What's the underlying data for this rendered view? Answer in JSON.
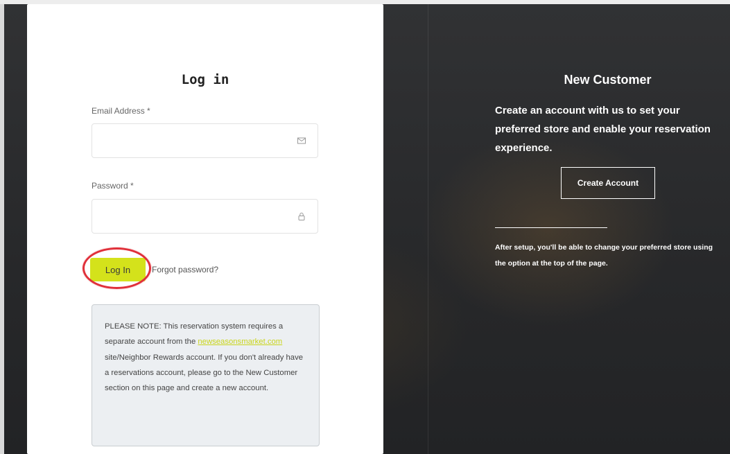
{
  "login": {
    "title": "Log in",
    "email_label": "Email Address *",
    "email_value": "",
    "password_label": "Password *",
    "password_value": "",
    "login_button": "Log In",
    "forgot_password": "Forgot password?",
    "note": {
      "text_before_link": "PLEASE NOTE: This reservation system requires a separate account from the ",
      "link_text": "newseasonsmarket.com",
      "text_after_link": " site/Neighbor Rewards account. If you don't already have a reservations account, please go to the New Customer section on this page and create a new account."
    }
  },
  "new_customer": {
    "title": "New Customer",
    "body": "Create an account with us to set your preferred store and enable your reservation experience.",
    "create_account_button": "Create Account",
    "after_setup": "After setup, you'll be able to change your preferred store using the option at the top of the page."
  },
  "icons": {
    "email_field": "envelope-icon",
    "password_field": "lock-icon"
  },
  "colors": {
    "accent": "#d4e21b",
    "highlight": "#e0303a",
    "dark_panel": "#2a2b2d"
  }
}
